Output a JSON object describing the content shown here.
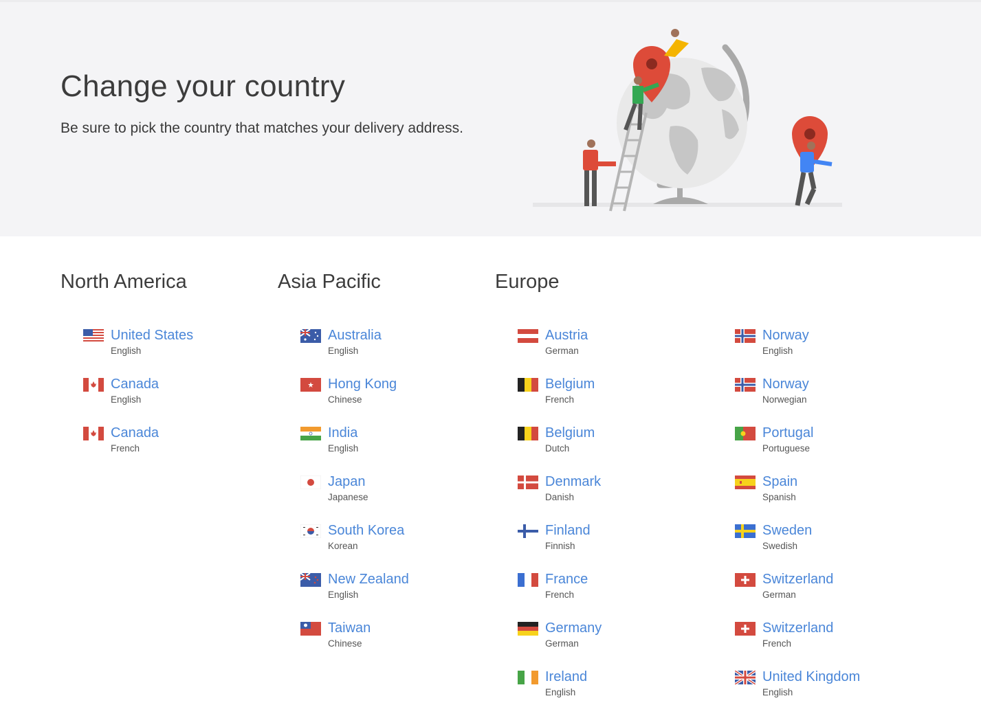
{
  "hero": {
    "title": "Change your country",
    "subtitle": "Be sure to pick the country that matches your delivery address."
  },
  "colors": {
    "link": "#4a86d8",
    "hero_background": "#f4f4f6",
    "heading": "#3c3c3c"
  },
  "regions": {
    "north_america": {
      "heading": "North America",
      "countries": [
        {
          "name": "United States",
          "language": "English",
          "flag": "us-flag-icon"
        },
        {
          "name": "Canada",
          "language": "English",
          "flag": "canada-flag-icon"
        },
        {
          "name": "Canada",
          "language": "French",
          "flag": "canada-flag-icon"
        }
      ]
    },
    "asia_pacific": {
      "heading": "Asia Pacific",
      "countries": [
        {
          "name": "Australia",
          "language": "English",
          "flag": "australia-flag-icon"
        },
        {
          "name": "Hong Kong",
          "language": "Chinese",
          "flag": "hong-kong-flag-icon"
        },
        {
          "name": "India",
          "language": "English",
          "flag": "india-flag-icon"
        },
        {
          "name": "Japan",
          "language": "Japanese",
          "flag": "japan-flag-icon"
        },
        {
          "name": "South Korea",
          "language": "Korean",
          "flag": "south-korea-flag-icon"
        },
        {
          "name": "New Zealand",
          "language": "English",
          "flag": "new-zealand-flag-icon"
        },
        {
          "name": "Taiwan",
          "language": "Chinese",
          "flag": "taiwan-flag-icon"
        }
      ]
    },
    "europe": {
      "heading": "Europe",
      "countries": [
        {
          "name": "Austria",
          "language": "German",
          "flag": "austria-flag-icon"
        },
        {
          "name": "Belgium",
          "language": "French",
          "flag": "belgium-flag-icon"
        },
        {
          "name": "Belgium",
          "language": "Dutch",
          "flag": "belgium-flag-icon"
        },
        {
          "name": "Denmark",
          "language": "Danish",
          "flag": "denmark-flag-icon"
        },
        {
          "name": "Finland",
          "language": "Finnish",
          "flag": "finland-flag-icon"
        },
        {
          "name": "France",
          "language": "French",
          "flag": "france-flag-icon"
        },
        {
          "name": "Germany",
          "language": "German",
          "flag": "germany-flag-icon"
        },
        {
          "name": "Ireland",
          "language": "English",
          "flag": "ireland-flag-icon"
        },
        {
          "name": "Norway",
          "language": "English",
          "flag": "norway-flag-icon"
        },
        {
          "name": "Norway",
          "language": "Norwegian",
          "flag": "norway-flag-icon"
        },
        {
          "name": "Portugal",
          "language": "Portuguese",
          "flag": "portugal-flag-icon"
        },
        {
          "name": "Spain",
          "language": "Spanish",
          "flag": "spain-flag-icon"
        },
        {
          "name": "Sweden",
          "language": "Swedish",
          "flag": "sweden-flag-icon"
        },
        {
          "name": "Switzerland",
          "language": "German",
          "flag": "switzerland-flag-icon"
        },
        {
          "name": "Switzerland",
          "language": "French",
          "flag": "switzerland-flag-icon"
        },
        {
          "name": "United Kingdom",
          "language": "English",
          "flag": "uk-flag-icon"
        }
      ]
    }
  }
}
